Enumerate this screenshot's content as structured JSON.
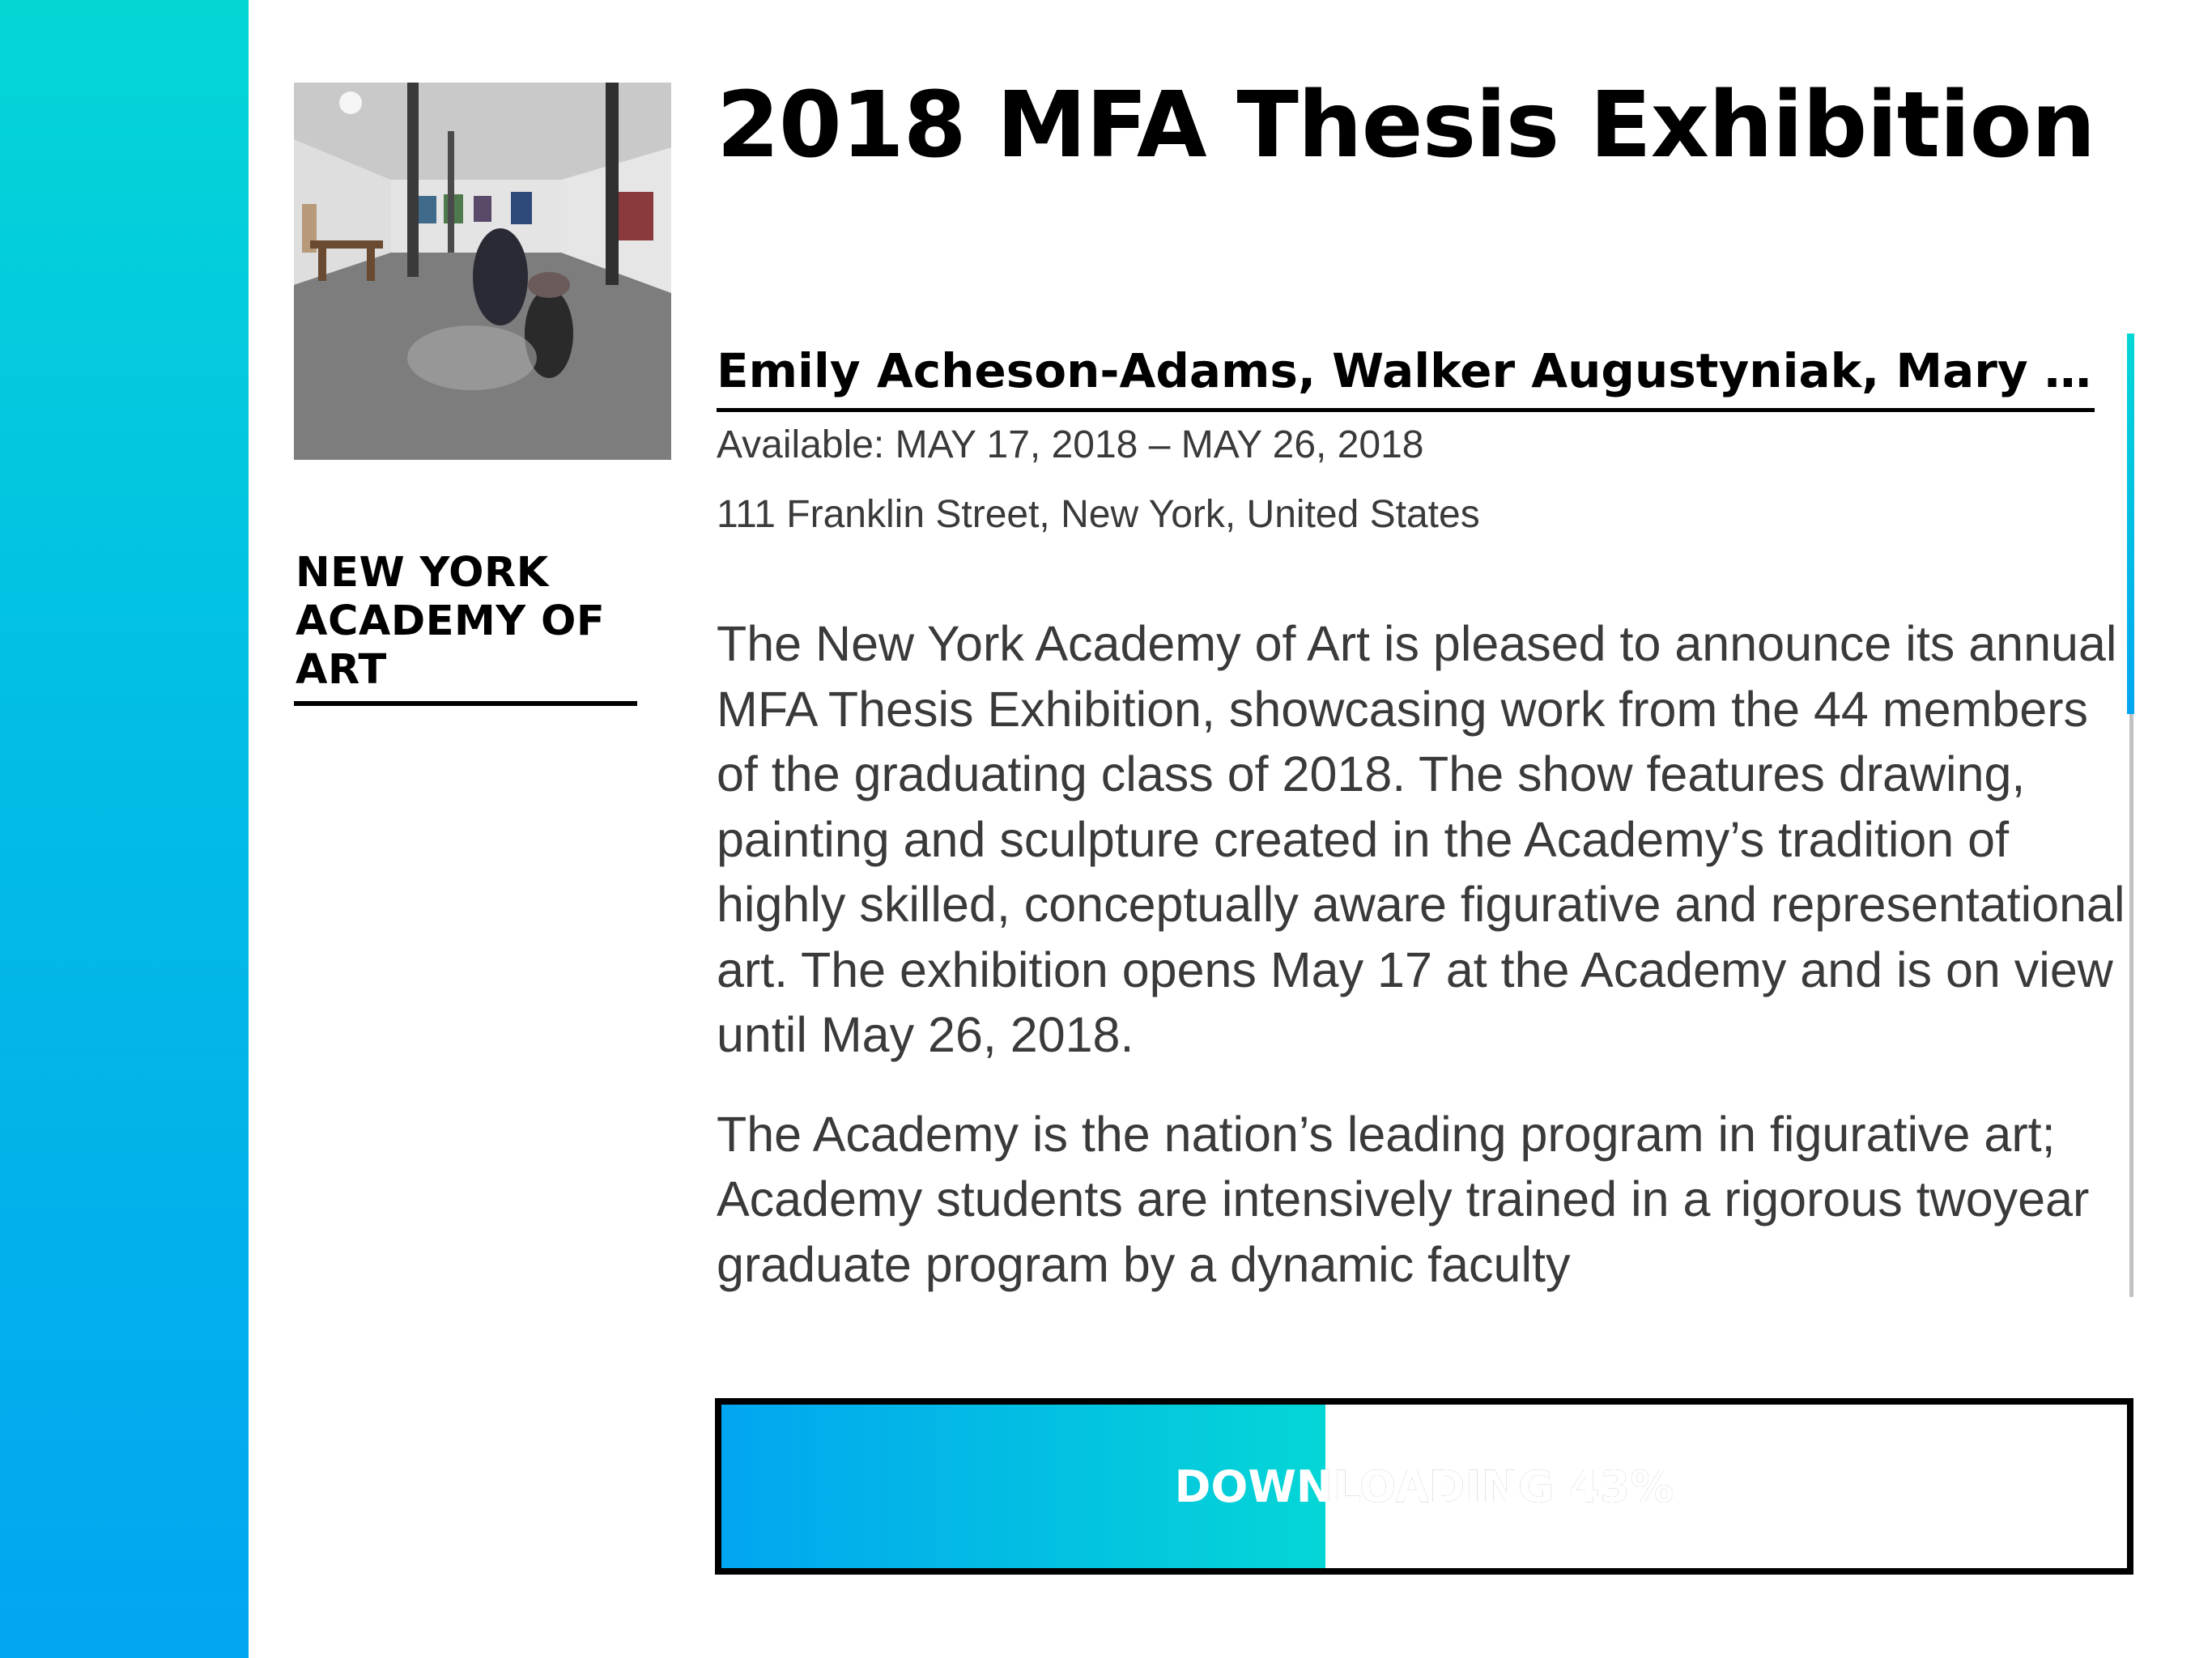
{
  "exhibition": {
    "title": "2018 MFA Thesis Exhibition",
    "artists": "Emily Acheson-Adams, Walker Augustyniak, Mary B...",
    "availability": "Available: MAY 17, 2018 – MAY 26, 2018",
    "address": "111 Franklin Street, New York, United States",
    "description": [
      "The New York Academy of Art is pleased to announce its annual MFA Thesis Exhibition, showcasing work from the 44 members of the graduating class of 2018. The show features drawing, painting and sculpture created in the Academy’s tradition of highly skilled, conceptually aware figurative and representational art. The exhibition opens May 17 at the Academy and is on view until May 26, 2018.",
      "The Academy is the nation’s leading program in figurative art; Academy students are intensively trained in a rigorous twoyear graduate program by a dynamic faculty"
    ]
  },
  "organization": {
    "name": "NEW YORK ACADEMY OF ART"
  },
  "download": {
    "label": "DOWNLOADING 43%",
    "progress": 0.43
  },
  "colors": {
    "accent_top": "#04d6d6",
    "accent_bottom": "#02a6f0"
  },
  "icons": {
    "gallery_image": "exhibition-photo"
  }
}
